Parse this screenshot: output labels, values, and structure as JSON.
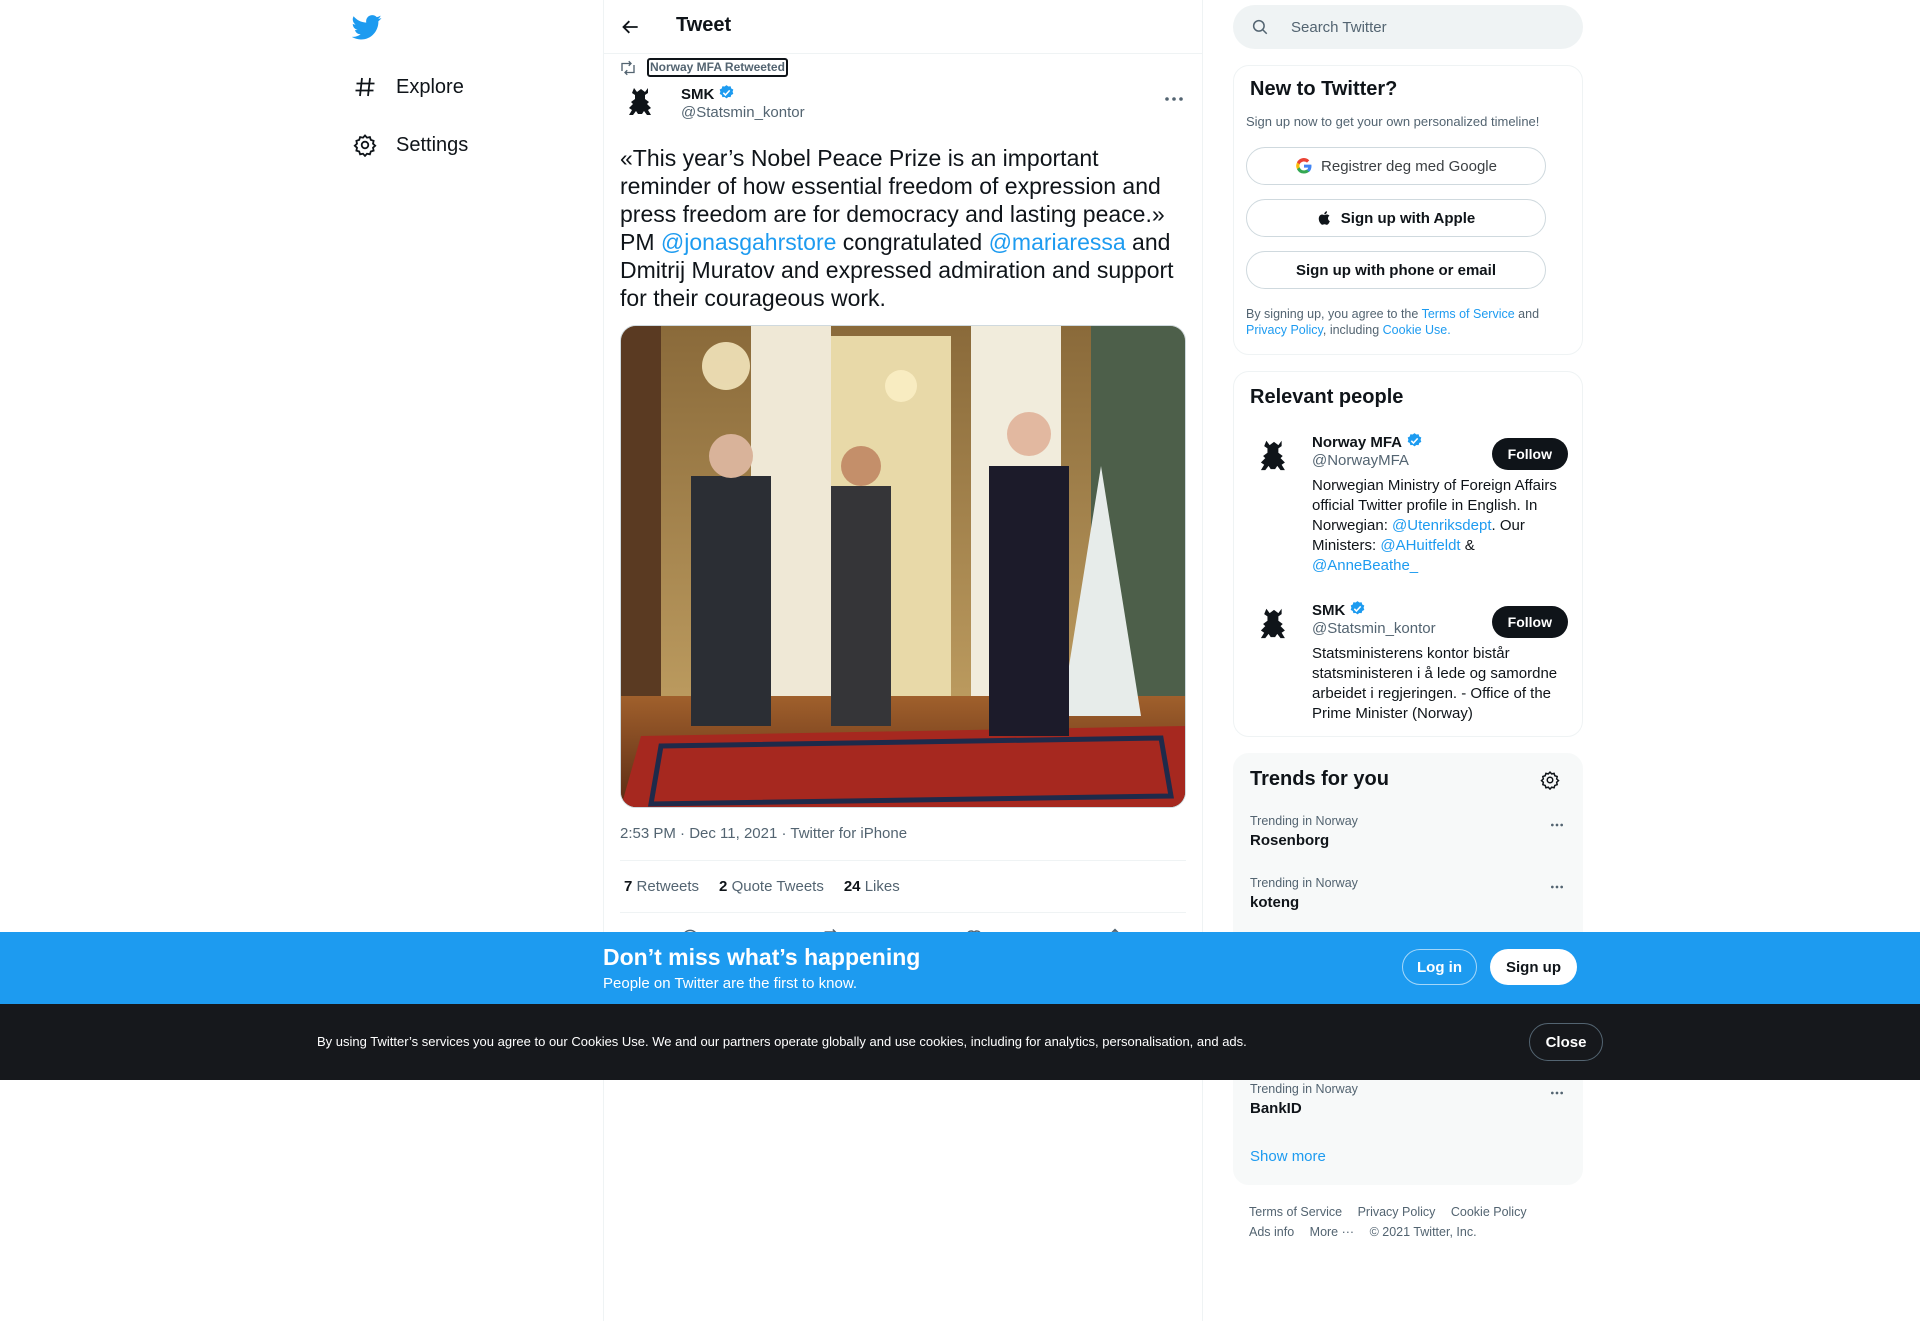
{
  "nav": {
    "logo_icon": "twitter-bird-icon",
    "items": [
      {
        "label": "Explore",
        "icon": "hashtag-icon"
      },
      {
        "label": "Settings",
        "icon": "gear-icon"
      }
    ]
  },
  "header": {
    "title": "Tweet",
    "back_icon": "arrow-left-icon"
  },
  "tweet": {
    "retweeted_by": "Norway MFA Retweeted",
    "author_name": "SMK",
    "author_handle": "@Statsmin_kontor",
    "text_before_mention1": "«This year’s Nobel Peace Prize is an important reminder of how essential freedom of expression and press freedom are for democracy and lasting peace.» PM ",
    "mention1": "@jonasgahrstore",
    "text_between": " congratulated ",
    "mention2": "@mariaressa",
    "text_after": " and Dmitrij Muratov and expressed admiration and support for their courageous work.",
    "meta": "2:53 PM · Dec 11, 2021 · Twitter for iPhone",
    "stats": {
      "retweets_count": "7",
      "retweets_label": "Retweets",
      "quotes_count": "2",
      "quotes_label": "Quote Tweets",
      "likes_count": "24",
      "likes_label": "Likes"
    }
  },
  "search": {
    "placeholder": "Search Twitter"
  },
  "new_to_twitter": {
    "title": "New to Twitter?",
    "subtitle": "Sign up now to get your own personalized timeline!",
    "google_label": "Registrer deg med Google",
    "apple_label": "Sign up with Apple",
    "phone_label": "Sign up with phone or email",
    "terms_prefix": "By signing up, you agree to the ",
    "terms_link": "Terms of Service",
    "terms_and": " and ",
    "privacy_link": "Privacy Policy",
    "including": ", including ",
    "cookie_link": "Cookie Use."
  },
  "relevant_people": {
    "title": "Relevant people",
    "people": [
      {
        "name": "Norway MFA",
        "handle": "@NorwayMFA",
        "bio_1": "Norwegian Ministry of Foreign Affairs official Twitter profile in English. In Norwegian: ",
        "bio_link1": "@Utenriksdept",
        "bio_2": ". Our Ministers: ",
        "bio_link2": "@AHuitfeldt",
        "bio_3": " & ",
        "bio_link3": "@AnneBeathe_",
        "follow_label": "Follow"
      },
      {
        "name": "SMK",
        "handle": "@Statsmin_kontor",
        "bio": "Statsministerens kontor bistår statsministeren i å lede og samordne arbeidet i regjeringen. - Office of the Prime Minister (Norway)",
        "follow_label": "Follow"
      }
    ]
  },
  "trends": {
    "title": "Trends for you",
    "items": [
      {
        "context": "Trending in Norway",
        "name": "Rosenborg"
      },
      {
        "context": "Trending in Norway",
        "name": "koteng"
      },
      {
        "context": "Trending in Norway",
        "name": "BankID"
      }
    ],
    "show_more": "Show more"
  },
  "footer": {
    "terms": "Terms of Service",
    "privacy": "Privacy Policy",
    "cookie": "Cookie Policy",
    "ads": "Ads info",
    "more": "More ···",
    "copyright": "© 2021 Twitter, Inc."
  },
  "banner": {
    "title": "Don’t miss what’s happening",
    "subtitle": "People on Twitter are the first to know.",
    "login_label": "Log in",
    "signup_label": "Sign up"
  },
  "cookie_bar": {
    "text": "By using Twitter’s services you agree to our Cookies Use. We and our partners operate globally and use cookies, including for analytics, personalisation, and ads.",
    "close_label": "Close"
  },
  "colors": {
    "accent": "#1d9bf0",
    "text": "#0f1419",
    "muted": "#536471",
    "cookie_bg": "#16181c"
  }
}
